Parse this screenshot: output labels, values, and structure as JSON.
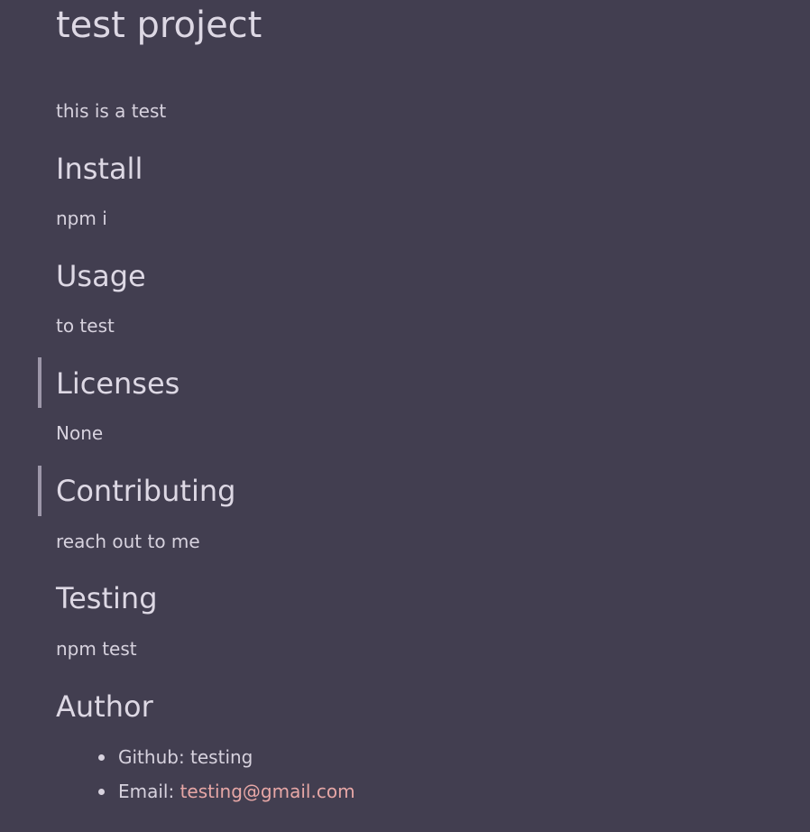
{
  "title": "test project",
  "description": "this is a test",
  "sections": {
    "install": {
      "heading": "Install",
      "body": "npm i"
    },
    "usage": {
      "heading": "Usage",
      "body": "to test"
    },
    "licenses": {
      "heading": "Licenses",
      "body": "None"
    },
    "contributing": {
      "heading": "Contributing",
      "body": "reach out to me"
    },
    "testing": {
      "heading": "Testing",
      "body": "npm test"
    },
    "author": {
      "heading": "Author",
      "github_label": "Github: testing",
      "email_label": "Email:",
      "email": "testing@gmail.com"
    }
  },
  "colors": {
    "background": "#423e50",
    "text": "#d7d2de",
    "link": "#e7a7a6",
    "marker": "#9d97a9"
  }
}
